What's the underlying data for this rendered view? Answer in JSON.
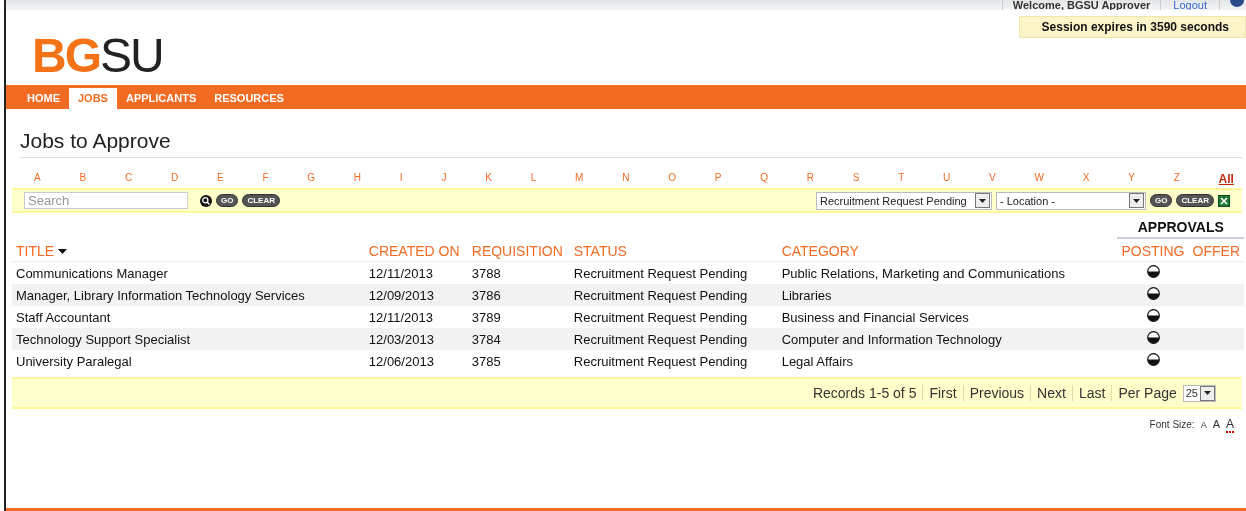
{
  "header": {
    "welcome": "Welcome, BGSU Approver",
    "logout": "Logout",
    "session": "Session expires in 3590 seconds",
    "logo": {
      "bold": "BG",
      "light": "SU"
    }
  },
  "tabs": [
    {
      "label": "HOME",
      "selected": false
    },
    {
      "label": "JOBS",
      "selected": true
    },
    {
      "label": "APPLICANTS",
      "selected": false
    },
    {
      "label": "RESOURCES",
      "selected": false
    }
  ],
  "page_title": "Jobs to Approve",
  "letters": [
    {
      "label": "A",
      "selected": false
    },
    {
      "label": "B",
      "selected": false
    },
    {
      "label": "C",
      "selected": false
    },
    {
      "label": "D",
      "selected": false
    },
    {
      "label": "E",
      "selected": false
    },
    {
      "label": "F",
      "selected": false
    },
    {
      "label": "G",
      "selected": false
    },
    {
      "label": "H",
      "selected": false
    },
    {
      "label": "I",
      "selected": false
    },
    {
      "label": "J",
      "selected": false
    },
    {
      "label": "K",
      "selected": false
    },
    {
      "label": "L",
      "selected": false
    },
    {
      "label": "M",
      "selected": false
    },
    {
      "label": "N",
      "selected": false
    },
    {
      "label": "O",
      "selected": false
    },
    {
      "label": "P",
      "selected": false
    },
    {
      "label": "Q",
      "selected": false
    },
    {
      "label": "R",
      "selected": false
    },
    {
      "label": "S",
      "selected": false
    },
    {
      "label": "T",
      "selected": false
    },
    {
      "label": "U",
      "selected": false
    },
    {
      "label": "V",
      "selected": false
    },
    {
      "label": "W",
      "selected": false
    },
    {
      "label": "X",
      "selected": false
    },
    {
      "label": "Y",
      "selected": false
    },
    {
      "label": "Z",
      "selected": false
    },
    {
      "label": "All",
      "selected": true
    }
  ],
  "filter": {
    "search_placeholder": "Search",
    "go": "GO",
    "clear": "CLEAR",
    "status_select": "Recruitment Request Pending",
    "location_select": "- Location -",
    "go2": "GO",
    "clear2": "CLEAR"
  },
  "table": {
    "group_header": "APPROVALS",
    "columns": [
      "TITLE",
      "CREATED ON",
      "REQUISITION",
      "STATUS",
      "CATEGORY",
      "POSTING",
      "OFFER"
    ],
    "rows": [
      {
        "title": "Communications Manager",
        "created": "12/11/2013",
        "requisition": "3788",
        "status": "Recruitment Request Pending",
        "category": "Public Relations, Marketing and Communications"
      },
      {
        "title": "Manager, Library Information Technology Services",
        "created": "12/09/2013",
        "requisition": "3786",
        "status": "Recruitment Request Pending",
        "category": "Libraries"
      },
      {
        "title": "Staff Accountant",
        "created": "12/11/2013",
        "requisition": "3789",
        "status": "Recruitment Request Pending",
        "category": "Business and Financial Services"
      },
      {
        "title": "Technology Support Specialist",
        "created": "12/03/2013",
        "requisition": "3784",
        "status": "Recruitment Request Pending",
        "category": "Computer and Information Technology"
      },
      {
        "title": "University Paralegal",
        "created": "12/06/2013",
        "requisition": "3785",
        "status": "Recruitment Request Pending",
        "category": "Legal Affairs"
      }
    ]
  },
  "pager": {
    "records": "Records 1-5 of 5",
    "links": [
      "First",
      "Previous",
      "Next",
      "Last"
    ],
    "per_page_label": "Per Page",
    "per_page": "25"
  },
  "font_size": {
    "label": "Font Size:",
    "options": [
      {
        "label": "A",
        "selected": false
      },
      {
        "label": "A",
        "selected": false
      },
      {
        "label": "A",
        "selected": true
      }
    ]
  }
}
